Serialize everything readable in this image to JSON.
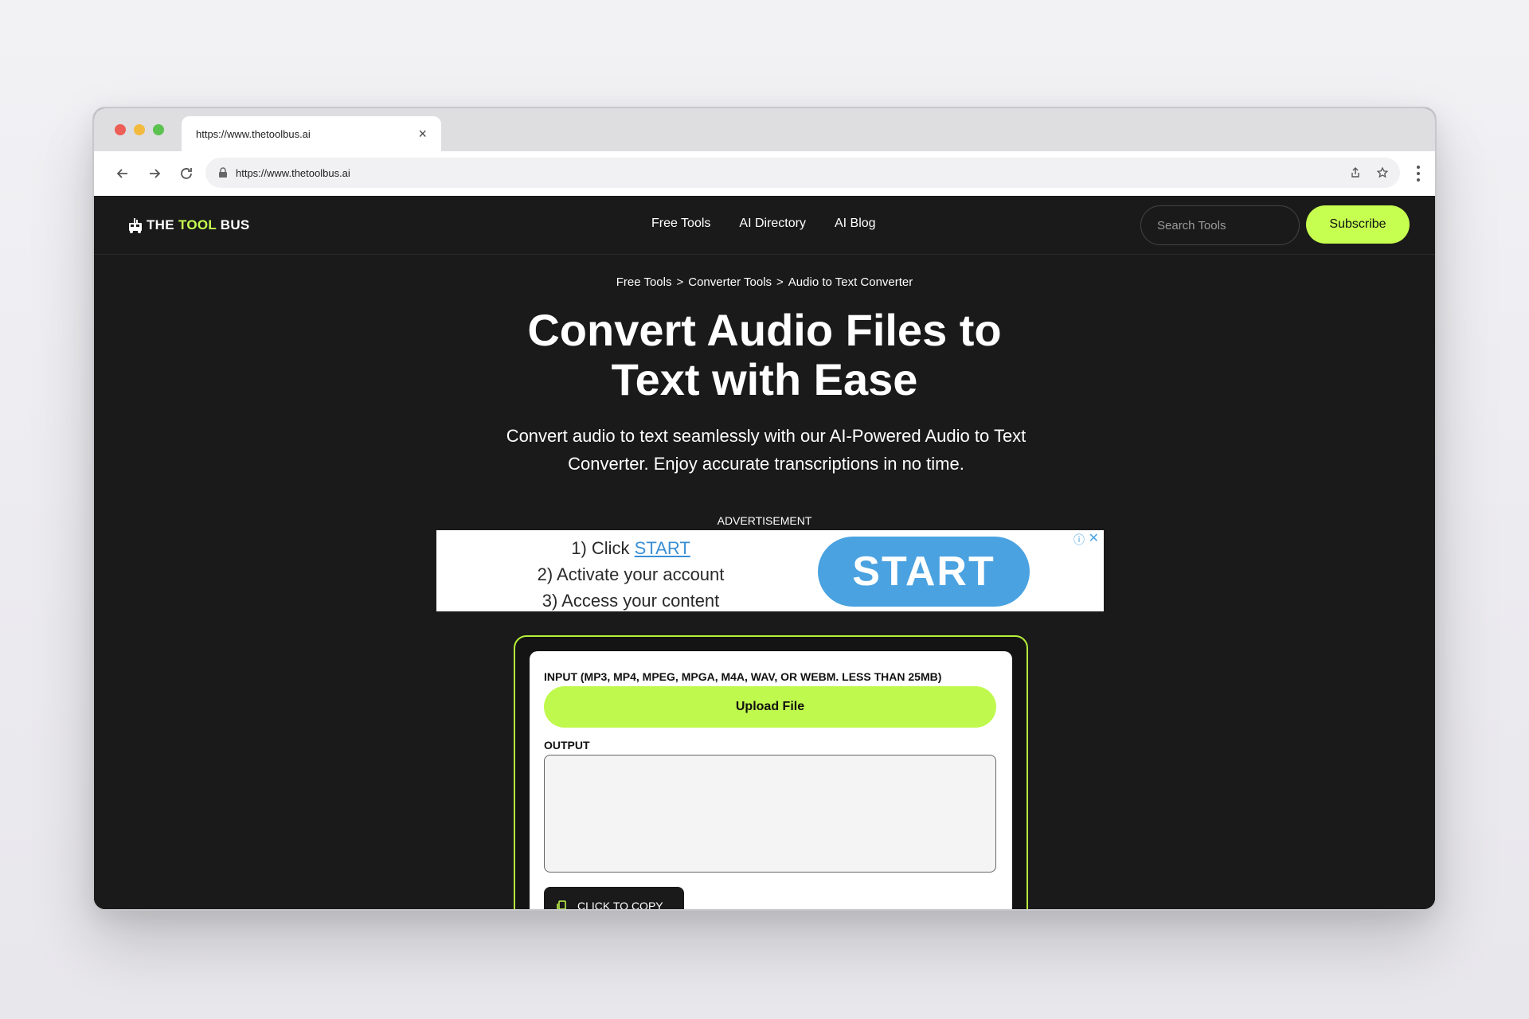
{
  "browser": {
    "tab_title": "https://www.thetoolbus.ai",
    "url": "https://www.thetoolbus.ai"
  },
  "site": {
    "logo_pre": "THE ",
    "logo_hl": "TOOL",
    "logo_post": " BUS",
    "nav": [
      "Free Tools",
      "AI Directory",
      "AI Blog"
    ],
    "search_placeholder": "Search Tools",
    "subscribe_label": "Subscribe",
    "accent_color": "#c6ff4f"
  },
  "breadcrumb": {
    "items": [
      "Free Tools",
      "Converter Tools",
      "Audio to Text Converter"
    ],
    "separator": ">"
  },
  "hero": {
    "title_line1": "Convert Audio Files to",
    "title_line2": "Text with Ease",
    "subtitle": "Convert audio to text seamlessly with our AI-Powered Audio to Text Converter. Enjoy accurate transcriptions in no time."
  },
  "ad": {
    "label": "ADVERTISEMENT",
    "line1_pre": "1) Click ",
    "line1_link": "START",
    "line2": "2) Activate your account",
    "line3": "3) Access your content",
    "button_label": "START"
  },
  "tool": {
    "input_label": "INPUT (MP3, MP4, MPEG, MPGA, M4A, WAV, OR WEBM. LESS THAN 25MB)",
    "upload_label": "Upload File",
    "output_label": "OUTPUT",
    "output_value": "",
    "copy_label": "CLICK TO COPY"
  }
}
